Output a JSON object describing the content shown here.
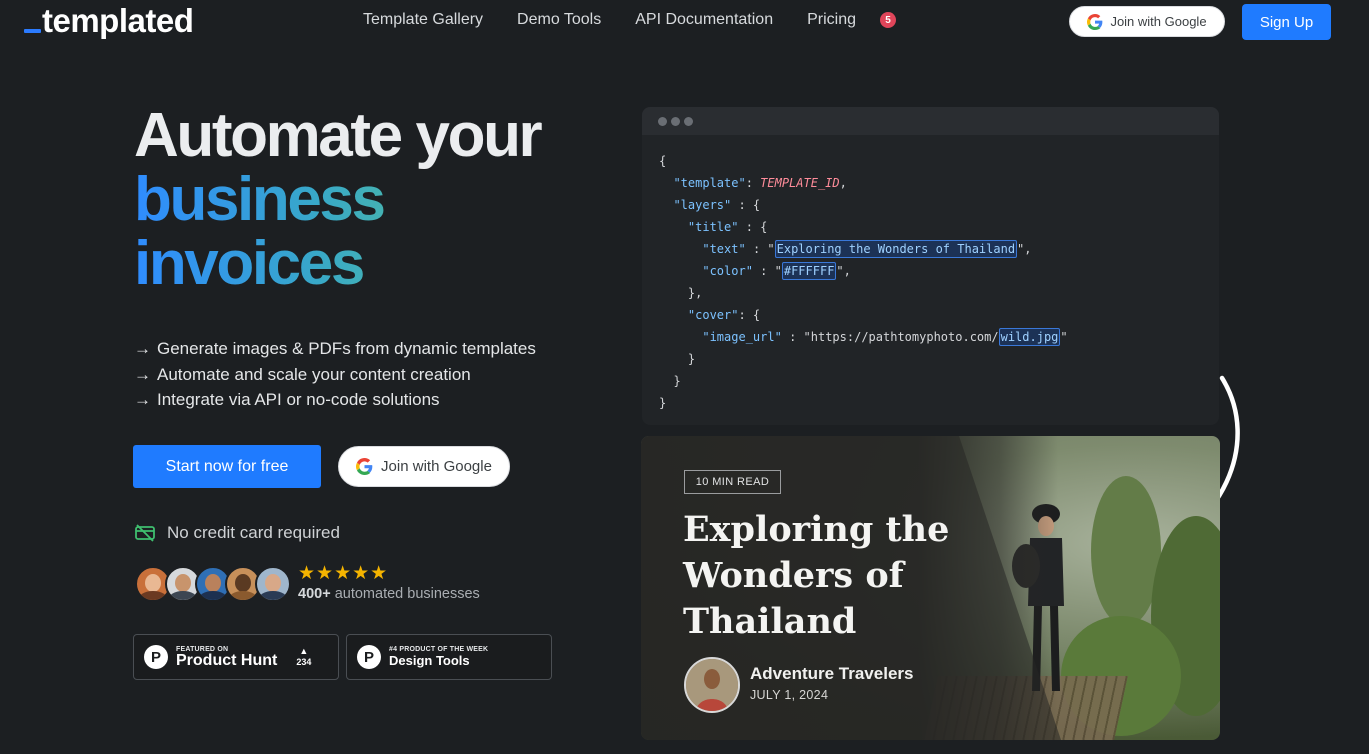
{
  "nav": {
    "logo": "templated",
    "links": [
      "Template Gallery",
      "Demo Tools",
      "API Documentation",
      "Pricing"
    ],
    "badge": "5",
    "google_label": "Join with Google",
    "signup_label": "Sign Up"
  },
  "hero": {
    "title_line1": "Automate your",
    "title_line2": "business",
    "title_line3": "invoices",
    "bullets": [
      "Generate images & PDFs from dynamic templates",
      "Automate and scale your content creation",
      "Integrate via API or no-code solutions"
    ],
    "bullet_arrow": "→",
    "start_label": "Start now for free",
    "google_label": "Join with Google",
    "no_credit": "No credit card required",
    "stars": "★★★★★",
    "rating_count": "400+",
    "rating_text": "automated businesses"
  },
  "badges": {
    "ph": {
      "small": "FEATURED ON",
      "big": "Product Hunt",
      "count": "234",
      "arrow": "▲",
      "logo": "P"
    },
    "potw": {
      "small": "#4 PRODUCT OF THE WEEK",
      "big": "Design Tools",
      "logo": "P"
    }
  },
  "code": {
    "template_key": "\"template\"",
    "template_val": "TEMPLATE_ID",
    "layers_key": "\"layers\"",
    "title_key": "\"title\"",
    "text_key": "\"text\"",
    "text_val": "Exploring the Wonders of Thailand",
    "color_key": "\"color\"",
    "color_val": "#FFFFFF",
    "cover_key": "\"cover\"",
    "image_key": "\"image_url\"",
    "image_prefix": "https://pathtomyphoto.com/",
    "image_file": "wild.jpg"
  },
  "card": {
    "tag": "10 MIN READ",
    "title": "Exploring the Wonders of Thailand",
    "author": "Adventure Travelers",
    "date": "JULY 1, 2024"
  },
  "colors": {
    "accent": "#1f7bff",
    "background": "#1c1f22",
    "gradient_start": "#2f8cff",
    "gradient_end": "#5fc985",
    "star": "#f5b400",
    "badge_red": "#e0455a"
  }
}
